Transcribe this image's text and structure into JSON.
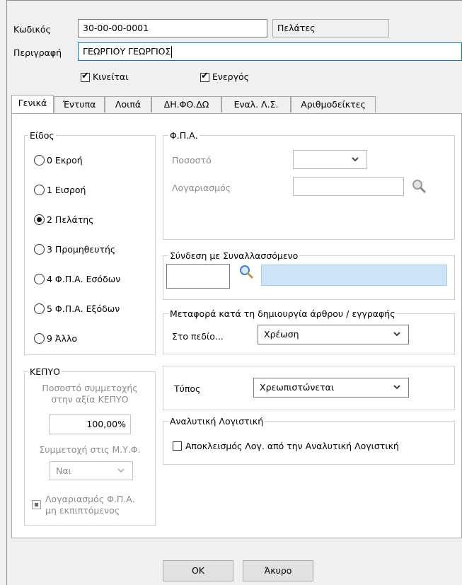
{
  "header": {
    "code_label": "Κωδικός",
    "code_value": "30-00-00-0001",
    "category_value": "Πελάτες",
    "description_label": "Περιγραφή",
    "description_value": "ΓΕΩΡΓΙΟΥ ΓΕΩΡΓΙΟΣ",
    "moving_label": "Κινείται",
    "active_label": "Ενεργός"
  },
  "tabs": [
    {
      "label": "Γενικά"
    },
    {
      "label": "Έντυπα"
    },
    {
      "label": "Λοιπά"
    },
    {
      "label": "ΔΗ.ΦΟ.ΔΩ"
    },
    {
      "label": "Εναλ. Λ.Σ."
    },
    {
      "label": "Αριθμοδείκτες"
    }
  ],
  "kind": {
    "title": "Είδος",
    "options": [
      {
        "label": "0 Εκροή"
      },
      {
        "label": "1 Εισροή"
      },
      {
        "label": "2 Πελάτης"
      },
      {
        "label": "3 Προμηθευτής"
      },
      {
        "label": "4 Φ.Π.Α. Εσόδων"
      },
      {
        "label": "5 Φ.Π.Α. Εξόδων"
      },
      {
        "label": "9 Άλλο"
      }
    ],
    "selected": "2 Πελάτης"
  },
  "vat": {
    "title": "Φ.Π.Α.",
    "rate_label": "Ποσοστό",
    "account_label": "Λογαριασμός"
  },
  "link": {
    "title": "Σύνδεση με Συναλλασσόμενο"
  },
  "transfer": {
    "title": "Μεταφορά κατά τη δημιουργία άρθρου / εγγραφής",
    "field_label": "Στο πεδίο...",
    "field_value": "Χρέωση"
  },
  "type": {
    "label": "Τύπος",
    "value": "Χρεωπιστώνεται"
  },
  "analytic": {
    "title": "Αναλυτική Λογιστική",
    "exclude_label": "Αποκλεισμός Λογ. από την Αναλυτική Λογιστική"
  },
  "kepyo": {
    "title": "ΚΕΠΥΟ",
    "share_label_1": "Ποσοστό συμμετοχής",
    "share_label_2": "στην αξία ΚΕΠΥΟ",
    "share_value": "100,00%",
    "myf_label": "Συμμετοχή στις Μ.Υ.Φ.",
    "myf_value": "Ναι",
    "vat_nondeductible_1": "Λογαριασμός Φ.Π.Α.",
    "vat_nondeductible_2": "μη εκπιπτόμενος"
  },
  "footer": {
    "ok_label": "OK",
    "cancel_label": "Άκυρο"
  },
  "icons": {
    "chevron": "∨",
    "checkmark": "✔"
  }
}
